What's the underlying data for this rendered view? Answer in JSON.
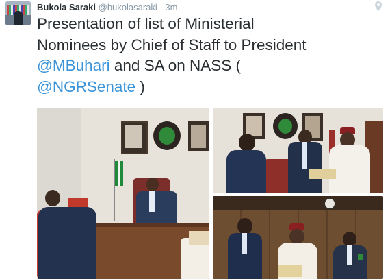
{
  "tweet": {
    "display_name": "Bukola Saraki",
    "handle": "@bukolasaraki",
    "separator": "·",
    "time": "3m",
    "text_line1": "Presentation of list of Ministerial",
    "text_line2": "Nominees by Chief of Staff to President",
    "mention_buhari": "@MBuhari",
    "text_after_mention": " and SA on NASS (",
    "mention_senate": "@NGRSenate",
    "text_close": " )"
  },
  "icons": {
    "avatar": "profile-photo",
    "location": "location-pin-icon"
  },
  "colors": {
    "link": "#3b94d9",
    "text": "#292f33",
    "meta": "#8899a6"
  }
}
